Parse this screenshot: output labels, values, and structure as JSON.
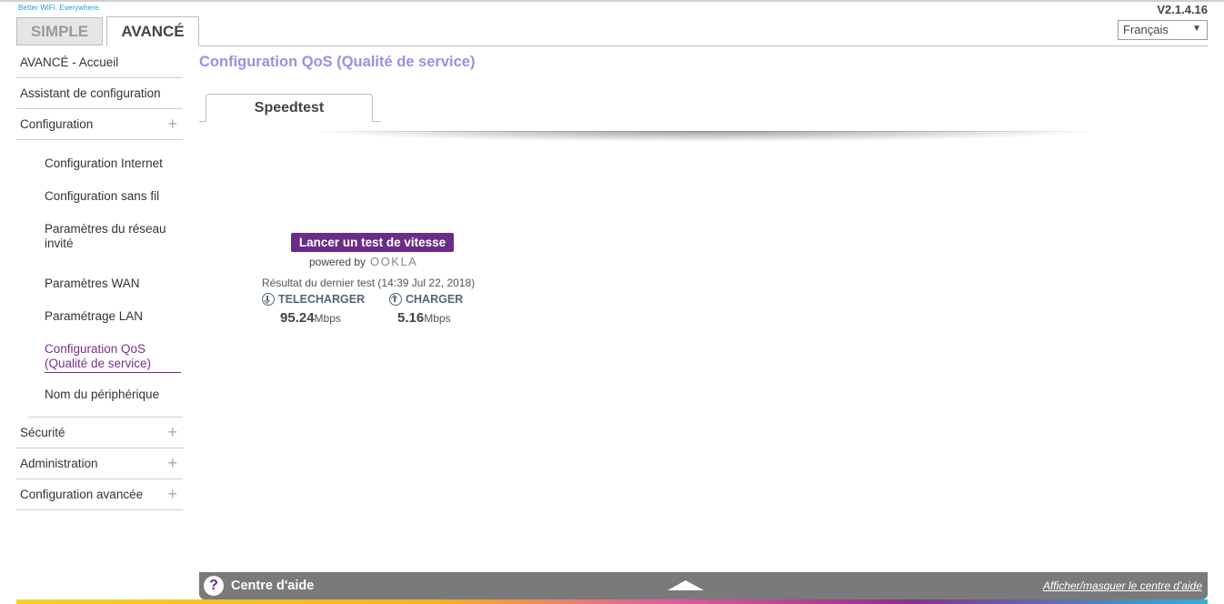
{
  "header": {
    "tagline": "Better WiFi. Everywhere.",
    "version": "V2.1.4.16",
    "mode_tabs": {
      "simple": "SIMPLE",
      "advanced": "AVANCÉ"
    },
    "language": "Français"
  },
  "sidebar": {
    "items": [
      {
        "label": "AVANCÉ - Accueil"
      },
      {
        "label": "Assistant de configuration"
      },
      {
        "label": "Configuration"
      },
      {
        "label": "Sécurité"
      },
      {
        "label": "Administration"
      },
      {
        "label": "Configuration avancée"
      }
    ],
    "sub_items": [
      {
        "label": "Configuration Internet"
      },
      {
        "label": "Configuration sans fil"
      },
      {
        "label": "Paramètres du réseau invité"
      },
      {
        "label": "Paramètres WAN"
      },
      {
        "label": "Paramétrage LAN"
      },
      {
        "label": "Configuration QoS (Qualité de service)"
      },
      {
        "label": "Nom du périphérique"
      }
    ]
  },
  "main": {
    "title": "Configuration QoS (Qualité de service)",
    "tab": "Speedtest",
    "speedtest": {
      "button": "Lancer un test de vitesse",
      "powered_by": "powered by",
      "brand": "OOKLA",
      "last_result": "Résultat du dernier test (14:39 Jul 22, 2018)",
      "download_label": "TELECHARGER",
      "download_value": "95.24",
      "upload_label": "CHARGER",
      "upload_value": "5.16",
      "unit": "Mbps"
    }
  },
  "help": {
    "title": "Centre d'aide",
    "toggle": "Afficher/masquer le centre d'aide"
  }
}
